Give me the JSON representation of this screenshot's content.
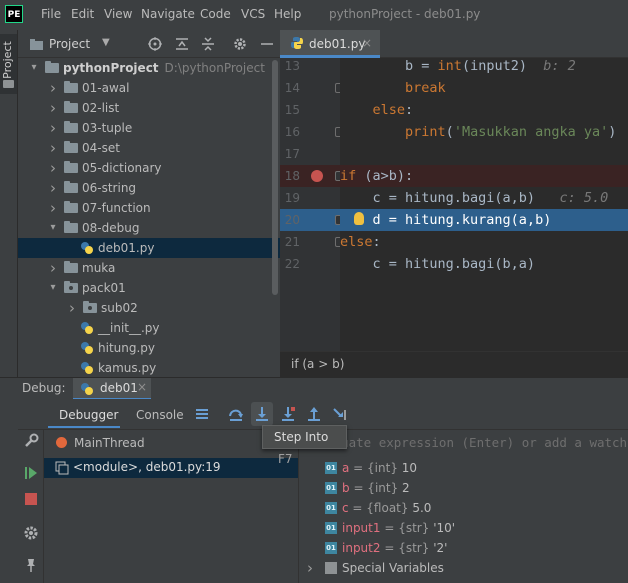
{
  "app": {
    "logo": "PE",
    "window_title": "pythonProject - deb01.py"
  },
  "menu": [
    "File",
    "Edit",
    "View",
    "Navigate",
    "Code",
    "VCS",
    "Help"
  ],
  "sidebar": {
    "project_tab": "Project"
  },
  "project_panel": {
    "title": "Project",
    "icons": [
      "target-icon",
      "collapse-all-icon",
      "expand-all-icon",
      "gear-icon",
      "minimize-icon"
    ],
    "tree": [
      {
        "label": "pythonProject",
        "path": "D:\\pythonProject",
        "type": "root",
        "expanded": true,
        "selected": false
      },
      {
        "label": "01-awal",
        "type": "folder",
        "expanded": false,
        "selected": false
      },
      {
        "label": "02-list",
        "type": "folder",
        "expanded": false,
        "selected": false
      },
      {
        "label": "03-tuple",
        "type": "folder",
        "expanded": false,
        "selected": false
      },
      {
        "label": "04-set",
        "type": "folder",
        "expanded": false,
        "selected": false
      },
      {
        "label": "05-dictionary",
        "type": "folder",
        "expanded": false,
        "selected": false
      },
      {
        "label": "06-string",
        "type": "folder",
        "expanded": false,
        "selected": false
      },
      {
        "label": "07-function",
        "type": "folder",
        "expanded": false,
        "selected": false
      },
      {
        "label": "08-debug",
        "type": "folder",
        "expanded": true,
        "selected": false
      },
      {
        "label": "deb01.py",
        "type": "pyfile",
        "expanded": false,
        "selected": true
      },
      {
        "label": "muka",
        "type": "folder",
        "expanded": false,
        "selected": false
      },
      {
        "label": "pack01",
        "type": "package",
        "expanded": true,
        "selected": false
      },
      {
        "label": "sub02",
        "type": "package",
        "expanded": false,
        "selected": false
      },
      {
        "label": "__init__.py",
        "type": "pyfile",
        "expanded": false,
        "selected": false
      },
      {
        "label": "hitung.py",
        "type": "pyfile",
        "expanded": false,
        "selected": false
      },
      {
        "label": "kamus.py",
        "type": "pyfile",
        "expanded": false,
        "selected": false
      }
    ]
  },
  "editor": {
    "tab_label": "deb01.py",
    "tab_close": "×",
    "lines": [
      {
        "no": "13",
        "text": "        b = int(input2)  b: 2",
        "marker": "none"
      },
      {
        "no": "14",
        "text": "        break",
        "marker": "none"
      },
      {
        "no": "15",
        "text": "    else:",
        "marker": "none"
      },
      {
        "no": "16",
        "text": "        print('Masukkan angka ya')",
        "marker": "none"
      },
      {
        "no": "17",
        "text": "",
        "marker": "none"
      },
      {
        "no": "18",
        "text": "if (a>b):",
        "marker": "breakpoint"
      },
      {
        "no": "19",
        "text": "    c = hitung.bagi(a,b)   c: 5.0",
        "marker": "none"
      },
      {
        "no": "20",
        "text": "    d = hitung.kurang(a,b)",
        "marker": "exec"
      },
      {
        "no": "21",
        "text": "else:",
        "marker": "none"
      },
      {
        "no": "22",
        "text": "    c = hitung.bagi(b,a)",
        "marker": "none"
      }
    ],
    "breadcrumb": "if (a > b)"
  },
  "debug": {
    "label": "Debug:",
    "config_name": "deb01",
    "tabs": [
      "Debugger",
      "Console"
    ],
    "tooltip_label": "Step Into",
    "tooltip_shortcut": "F7",
    "thread": "MainThread",
    "frame": "<module>, deb01.py:19",
    "watch_placeholder": "Evaluate expression (Enter) or add a watch (Ctrl+Shift+Enter)",
    "variables": [
      {
        "badge": "01",
        "name": "a",
        "type": " = {int} ",
        "value": "10"
      },
      {
        "badge": "01",
        "name": "b",
        "type": " = {int} ",
        "value": "2"
      },
      {
        "badge": "01",
        "name": "c",
        "type": " = {float} ",
        "value": "5.0"
      },
      {
        "badge": "01",
        "name": "input1",
        "type": " = {str} ",
        "value": "'10'"
      },
      {
        "badge": "01",
        "name": "input2",
        "type": " = {str} ",
        "value": "'2'"
      }
    ],
    "special_vars": "Special Variables"
  },
  "colors": {
    "accent": "#4a88c7",
    "breakpoint": "#c75450",
    "exec_line": "#2d5f8c"
  }
}
